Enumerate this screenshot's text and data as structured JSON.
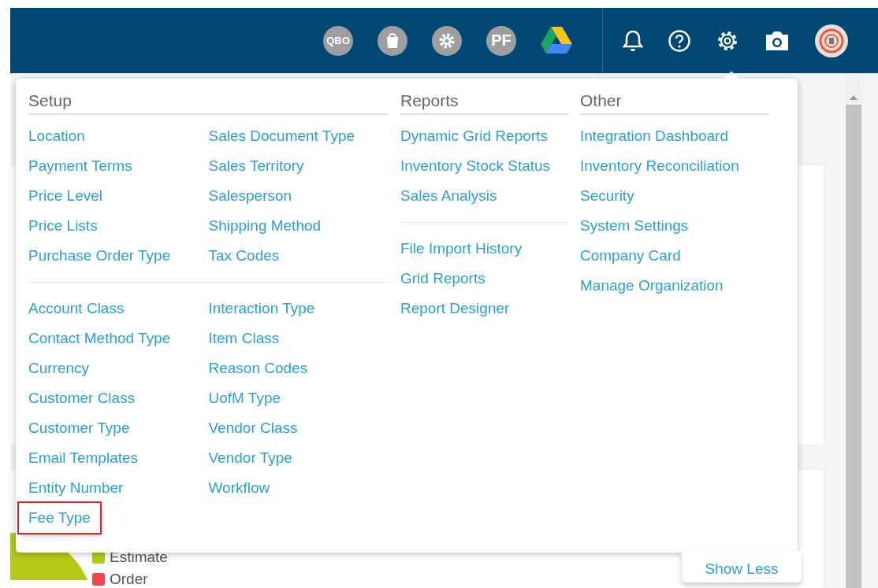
{
  "top_bar": {
    "app_icons": [
      {
        "kind": "qbo",
        "label": "QBO"
      },
      {
        "kind": "bag"
      },
      {
        "kind": "gear"
      },
      {
        "kind": "pf",
        "label": "PF"
      },
      {
        "kind": "drive"
      }
    ],
    "user_icons": [
      {
        "kind": "bell"
      },
      {
        "kind": "help"
      },
      {
        "kind": "settings"
      },
      {
        "kind": "camera"
      },
      {
        "kind": "avatar"
      }
    ]
  },
  "menu": {
    "sections": [
      {
        "title": "Setup",
        "groups": [
          {
            "columns": [
              [
                {
                  "label": "Location",
                  "highlighted": false
                },
                {
                  "label": "Payment Terms",
                  "highlighted": false
                },
                {
                  "label": "Price Level",
                  "highlighted": false
                },
                {
                  "label": "Price Lists",
                  "highlighted": false
                },
                {
                  "label": "Purchase Order Type",
                  "highlighted": false
                }
              ],
              [
                {
                  "label": "Sales Document Type",
                  "highlighted": false
                },
                {
                  "label": "Sales Territory",
                  "highlighted": false
                },
                {
                  "label": "Salesperson",
                  "highlighted": false
                },
                {
                  "label": "Shipping Method",
                  "highlighted": false
                },
                {
                  "label": "Tax Codes",
                  "highlighted": false
                }
              ]
            ]
          },
          {
            "columns": [
              [
                {
                  "label": "Account Class",
                  "highlighted": false
                },
                {
                  "label": "Contact Method Type",
                  "highlighted": false
                },
                {
                  "label": "Currency",
                  "highlighted": false
                },
                {
                  "label": "Customer Class",
                  "highlighted": false
                },
                {
                  "label": "Customer Type",
                  "highlighted": false
                },
                {
                  "label": "Email Templates",
                  "highlighted": false
                },
                {
                  "label": "Entity Number",
                  "highlighted": false
                },
                {
                  "label": "Fee Type",
                  "highlighted": true
                }
              ],
              [
                {
                  "label": "Interaction Type",
                  "highlighted": false
                },
                {
                  "label": "Item Class",
                  "highlighted": false
                },
                {
                  "label": "Reason Codes",
                  "highlighted": false
                },
                {
                  "label": "UofM Type",
                  "highlighted": false
                },
                {
                  "label": "Vendor Class",
                  "highlighted": false
                },
                {
                  "label": "Vendor Type",
                  "highlighted": false
                },
                {
                  "label": "Workflow",
                  "highlighted": false
                }
              ]
            ]
          }
        ]
      },
      {
        "title": "Reports",
        "groups": [
          {
            "columns": [
              [
                {
                  "label": "Dynamic Grid Reports",
                  "highlighted": false
                },
                {
                  "label": "Inventory Stock Status",
                  "highlighted": false
                },
                {
                  "label": "Sales Analysis",
                  "highlighted": false
                }
              ]
            ]
          },
          {
            "columns": [
              [
                {
                  "label": "File Import History",
                  "highlighted": false
                },
                {
                  "label": "Grid Reports",
                  "highlighted": false
                },
                {
                  "label": "Report Designer",
                  "highlighted": false
                }
              ]
            ]
          }
        ]
      },
      {
        "title": "Other",
        "groups": [
          {
            "columns": [
              [
                {
                  "label": "Integration Dashboard",
                  "highlighted": false
                },
                {
                  "label": "Inventory Reconciliation",
                  "highlighted": false
                },
                {
                  "label": "Security",
                  "highlighted": false
                },
                {
                  "label": "System Settings",
                  "highlighted": false
                },
                {
                  "label": "Company Card",
                  "highlighted": false
                },
                {
                  "label": "Manage Organization",
                  "highlighted": false
                }
              ]
            ]
          }
        ]
      }
    ],
    "toggle": "Show Less"
  },
  "legend": [
    {
      "label": "Estimate",
      "color": "#b5c918"
    },
    {
      "label": "Order",
      "color": "#f0444f"
    }
  ]
}
